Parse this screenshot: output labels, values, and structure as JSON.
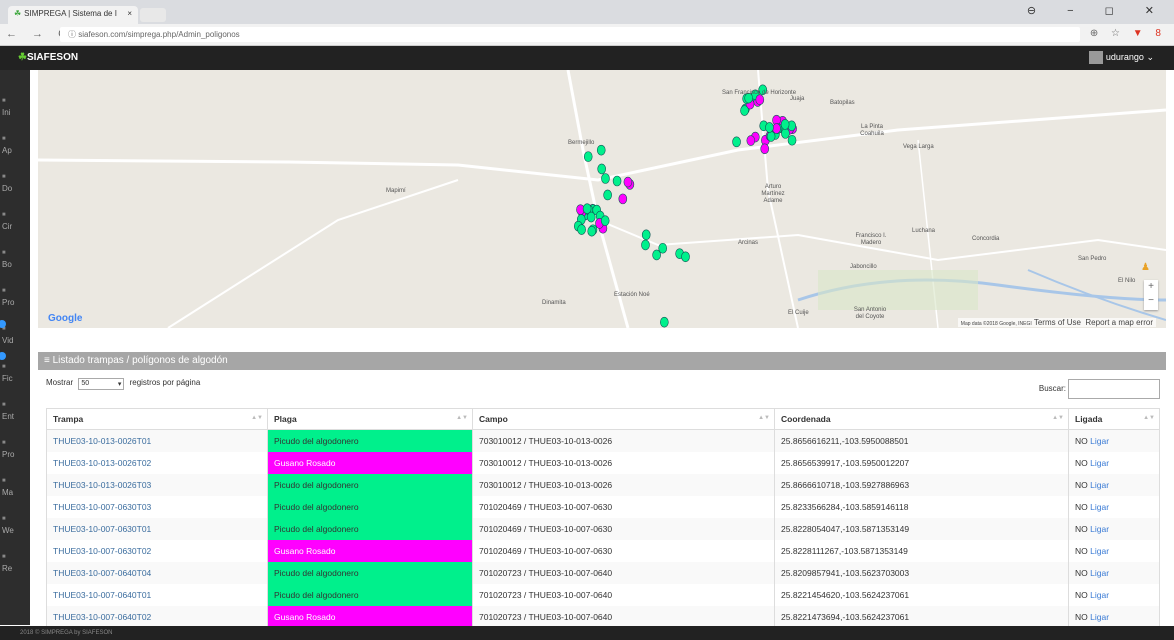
{
  "browser": {
    "tab_title": "SIMPREGA | Sistema de I",
    "url": "siafeson.com/simprega.php/Admin_poligonos",
    "tab_close": "×",
    "nav_glyphs": "← → C",
    "addr_glyphs": "⊕ ☆",
    "ext_glyph": "▼ 8",
    "window_controls": "⊖ − ◻ ✕"
  },
  "topbar": {
    "brand": "SIAFESON",
    "user": "udurango",
    "user_caret": "⌄"
  },
  "sidebar": {
    "items": [
      {
        "label": "Ini"
      },
      {
        "label": "Ap"
      },
      {
        "label": "Do"
      },
      {
        "label": "Cir"
      },
      {
        "label": "Bo"
      },
      {
        "label": "Pro"
      },
      {
        "label": "Vid"
      },
      {
        "label": "Fic"
      },
      {
        "label": "Ent"
      },
      {
        "label": "Pro"
      },
      {
        "label": "Ma"
      },
      {
        "label": "We"
      },
      {
        "label": "Re"
      }
    ]
  },
  "map": {
    "labels": [
      "San Francisco de Horizonte",
      "Juaja",
      "Batopilas",
      "La Pinta Coahuila",
      "Vega Larga",
      "Bermejillo",
      "Mapimí",
      "Arturo Martínez Adame",
      "Francisco I. Madero",
      "Luchana",
      "Concordia",
      "Arcinas",
      "Jaboncillo",
      "San Pedro",
      "El Nilo",
      "Estación Noé",
      "Dinamita",
      "El Cuije",
      "San Antonio del Coyote"
    ],
    "google": "Google",
    "credit": "Map data ©2018 Google, INEGI",
    "terms": "Terms of Use",
    "report": "Report a map error",
    "pegman": "♟",
    "zoom_in": "+",
    "zoom_out": "−"
  },
  "panel": {
    "title": "≡ Listado trampas / polígonos de algodón",
    "show_label": "Mostrar",
    "page_size": "50",
    "page_size_caret": "▾",
    "per_page_label": "registros por página",
    "search_label": "Buscar:"
  },
  "table": {
    "headers": [
      "Trampa",
      "Plaga",
      "Campo",
      "Coordenada",
      "Ligada"
    ],
    "rows": [
      {
        "trampa": "THUE03-10-013-0026T01",
        "plaga": "Picudo del algodonero",
        "campo": "703010012 / THUE03-10-013-0026",
        "coord": "25.8656616211,-103.5950088501",
        "ligada": "NO",
        "link": "Ligar"
      },
      {
        "trampa": "THUE03-10-013-0026T02",
        "plaga": "Gusano Rosado",
        "campo": "703010012 / THUE03-10-013-0026",
        "coord": "25.8656539917,-103.5950012207",
        "ligada": "NO",
        "link": "Ligar"
      },
      {
        "trampa": "THUE03-10-013-0026T03",
        "plaga": "Picudo del algodonero",
        "campo": "703010012 / THUE03-10-013-0026",
        "coord": "25.8666610718,-103.5927886963",
        "ligada": "NO",
        "link": "Ligar"
      },
      {
        "trampa": "THUE03-10-007-0630T03",
        "plaga": "Picudo del algodonero",
        "campo": "701020469 / THUE03-10-007-0630",
        "coord": "25.8233566284,-103.5859146118",
        "ligada": "NO",
        "link": "Ligar"
      },
      {
        "trampa": "THUE03-10-007-0630T01",
        "plaga": "Picudo del algodonero",
        "campo": "701020469 / THUE03-10-007-0630",
        "coord": "25.8228054047,-103.5871353149",
        "ligada": "NO",
        "link": "Ligar"
      },
      {
        "trampa": "THUE03-10-007-0630T02",
        "plaga": "Gusano Rosado",
        "campo": "701020469 / THUE03-10-007-0630",
        "coord": "25.8228111267,-103.5871353149",
        "ligada": "NO",
        "link": "Ligar"
      },
      {
        "trampa": "THUE03-10-007-0640T04",
        "plaga": "Picudo del algodonero",
        "campo": "701020723 / THUE03-10-007-0640",
        "coord": "25.8209857941,-103.5623703003",
        "ligada": "NO",
        "link": "Ligar"
      },
      {
        "trampa": "THUE03-10-007-0640T01",
        "plaga": "Picudo del algodonero",
        "campo": "701020723 / THUE03-10-007-0640",
        "coord": "25.8221454620,-103.5624237061",
        "ligada": "NO",
        "link": "Ligar"
      },
      {
        "trampa": "THUE03-10-007-0640T02",
        "plaga": "Gusano Rosado",
        "campo": "701020723 / THUE03-10-007-0640",
        "coord": "25.8221473694,-103.5624237061",
        "ligada": "NO",
        "link": "Ligar"
      }
    ]
  },
  "footer": "2018 © SIMPREGA by SIAFESON",
  "colors": {
    "picudo": "#00f08c",
    "gusano": "#ff00ff",
    "header_bar": "#a6a6a6"
  }
}
